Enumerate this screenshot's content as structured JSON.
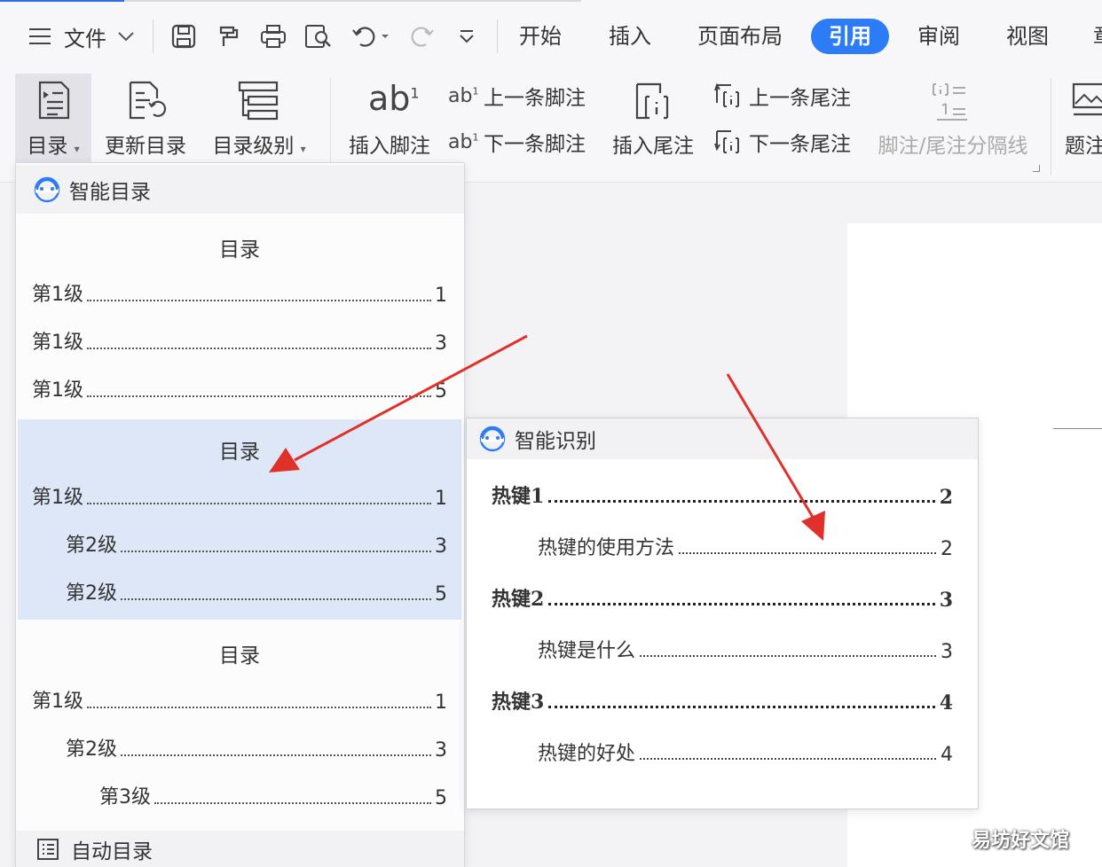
{
  "colors": {
    "accent": "#2b7cf6",
    "arrow": "#e0302a",
    "highlight": "#dde7f7"
  },
  "tabbar": {
    "file_label": "文件",
    "tabs": [
      "开始",
      "插入",
      "页面布局",
      "引用",
      "审阅",
      "视图",
      "章"
    ],
    "active_tab": "引用",
    "icons": [
      "menu-icon",
      "chevron-down-icon",
      "save-icon",
      "format-painter-icon",
      "print-icon",
      "print-preview-icon",
      "undo-icon",
      "redo-icon",
      "more-icon"
    ]
  },
  "ribbon": {
    "toc_label": "目录",
    "update_toc_label": "更新目录",
    "toc_level_label": "目录级别",
    "insert_footnote_label": "插入脚注",
    "prev_footnote_label": "上一条脚注",
    "next_footnote_label": "下一条脚注",
    "insert_endnote_label": "插入尾注",
    "prev_endnote_label": "上一条尾注",
    "next_endnote_label": "下一条尾注",
    "separator_label": "脚注/尾注分隔线",
    "caption_label": "题注"
  },
  "dropdown": {
    "smart_toc_label": "智能目录",
    "auto_toc_label": "自动目录",
    "previews": [
      {
        "title": "目录",
        "rows": [
          {
            "label": "第1级",
            "page": "1"
          },
          {
            "label": "第1级",
            "page": "3"
          },
          {
            "label": "第1级",
            "page": "5"
          }
        ]
      },
      {
        "title": "目录",
        "rows": [
          {
            "label": "第1级",
            "page": "1"
          },
          {
            "label": "第2级",
            "page": "3"
          },
          {
            "label": "第2级",
            "page": "5"
          }
        ]
      },
      {
        "title": "目录",
        "rows": [
          {
            "label": "第1级",
            "page": "1"
          },
          {
            "label": "第2级",
            "page": "3"
          },
          {
            "label": "第3级",
            "page": "5"
          }
        ]
      }
    ]
  },
  "smart_panel": {
    "title": "智能识别",
    "rows": [
      {
        "label": "热键1",
        "page": "2"
      },
      {
        "label": "热键的使用方法",
        "page": "2"
      },
      {
        "label": "热键2",
        "page": "3"
      },
      {
        "label": "热键是什么",
        "page": "3"
      },
      {
        "label": "热键3",
        "page": "4"
      },
      {
        "label": "热键的好处",
        "page": "4"
      }
    ]
  },
  "watermark": "易坊好文馆"
}
